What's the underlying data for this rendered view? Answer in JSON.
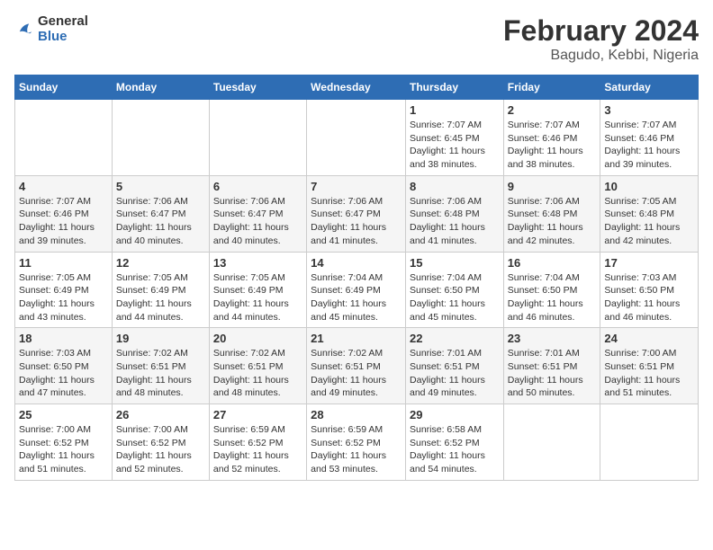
{
  "header": {
    "logo_general": "General",
    "logo_blue": "Blue",
    "title": "February 2024",
    "subtitle": "Bagudo, Kebbi, Nigeria"
  },
  "days_of_week": [
    "Sunday",
    "Monday",
    "Tuesday",
    "Wednesday",
    "Thursday",
    "Friday",
    "Saturday"
  ],
  "weeks": [
    [
      {
        "day": "",
        "info": ""
      },
      {
        "day": "",
        "info": ""
      },
      {
        "day": "",
        "info": ""
      },
      {
        "day": "",
        "info": ""
      },
      {
        "day": "1",
        "info": "Sunrise: 7:07 AM\nSunset: 6:45 PM\nDaylight: 11 hours and 38 minutes."
      },
      {
        "day": "2",
        "info": "Sunrise: 7:07 AM\nSunset: 6:46 PM\nDaylight: 11 hours and 38 minutes."
      },
      {
        "day": "3",
        "info": "Sunrise: 7:07 AM\nSunset: 6:46 PM\nDaylight: 11 hours and 39 minutes."
      }
    ],
    [
      {
        "day": "4",
        "info": "Sunrise: 7:07 AM\nSunset: 6:46 PM\nDaylight: 11 hours and 39 minutes."
      },
      {
        "day": "5",
        "info": "Sunrise: 7:06 AM\nSunset: 6:47 PM\nDaylight: 11 hours and 40 minutes."
      },
      {
        "day": "6",
        "info": "Sunrise: 7:06 AM\nSunset: 6:47 PM\nDaylight: 11 hours and 40 minutes."
      },
      {
        "day": "7",
        "info": "Sunrise: 7:06 AM\nSunset: 6:47 PM\nDaylight: 11 hours and 41 minutes."
      },
      {
        "day": "8",
        "info": "Sunrise: 7:06 AM\nSunset: 6:48 PM\nDaylight: 11 hours and 41 minutes."
      },
      {
        "day": "9",
        "info": "Sunrise: 7:06 AM\nSunset: 6:48 PM\nDaylight: 11 hours and 42 minutes."
      },
      {
        "day": "10",
        "info": "Sunrise: 7:05 AM\nSunset: 6:48 PM\nDaylight: 11 hours and 42 minutes."
      }
    ],
    [
      {
        "day": "11",
        "info": "Sunrise: 7:05 AM\nSunset: 6:49 PM\nDaylight: 11 hours and 43 minutes."
      },
      {
        "day": "12",
        "info": "Sunrise: 7:05 AM\nSunset: 6:49 PM\nDaylight: 11 hours and 44 minutes."
      },
      {
        "day": "13",
        "info": "Sunrise: 7:05 AM\nSunset: 6:49 PM\nDaylight: 11 hours and 44 minutes."
      },
      {
        "day": "14",
        "info": "Sunrise: 7:04 AM\nSunset: 6:49 PM\nDaylight: 11 hours and 45 minutes."
      },
      {
        "day": "15",
        "info": "Sunrise: 7:04 AM\nSunset: 6:50 PM\nDaylight: 11 hours and 45 minutes."
      },
      {
        "day": "16",
        "info": "Sunrise: 7:04 AM\nSunset: 6:50 PM\nDaylight: 11 hours and 46 minutes."
      },
      {
        "day": "17",
        "info": "Sunrise: 7:03 AM\nSunset: 6:50 PM\nDaylight: 11 hours and 46 minutes."
      }
    ],
    [
      {
        "day": "18",
        "info": "Sunrise: 7:03 AM\nSunset: 6:50 PM\nDaylight: 11 hours and 47 minutes."
      },
      {
        "day": "19",
        "info": "Sunrise: 7:02 AM\nSunset: 6:51 PM\nDaylight: 11 hours and 48 minutes."
      },
      {
        "day": "20",
        "info": "Sunrise: 7:02 AM\nSunset: 6:51 PM\nDaylight: 11 hours and 48 minutes."
      },
      {
        "day": "21",
        "info": "Sunrise: 7:02 AM\nSunset: 6:51 PM\nDaylight: 11 hours and 49 minutes."
      },
      {
        "day": "22",
        "info": "Sunrise: 7:01 AM\nSunset: 6:51 PM\nDaylight: 11 hours and 49 minutes."
      },
      {
        "day": "23",
        "info": "Sunrise: 7:01 AM\nSunset: 6:51 PM\nDaylight: 11 hours and 50 minutes."
      },
      {
        "day": "24",
        "info": "Sunrise: 7:00 AM\nSunset: 6:51 PM\nDaylight: 11 hours and 51 minutes."
      }
    ],
    [
      {
        "day": "25",
        "info": "Sunrise: 7:00 AM\nSunset: 6:52 PM\nDaylight: 11 hours and 51 minutes."
      },
      {
        "day": "26",
        "info": "Sunrise: 7:00 AM\nSunset: 6:52 PM\nDaylight: 11 hours and 52 minutes."
      },
      {
        "day": "27",
        "info": "Sunrise: 6:59 AM\nSunset: 6:52 PM\nDaylight: 11 hours and 52 minutes."
      },
      {
        "day": "28",
        "info": "Sunrise: 6:59 AM\nSunset: 6:52 PM\nDaylight: 11 hours and 53 minutes."
      },
      {
        "day": "29",
        "info": "Sunrise: 6:58 AM\nSunset: 6:52 PM\nDaylight: 11 hours and 54 minutes."
      },
      {
        "day": "",
        "info": ""
      },
      {
        "day": "",
        "info": ""
      }
    ]
  ]
}
